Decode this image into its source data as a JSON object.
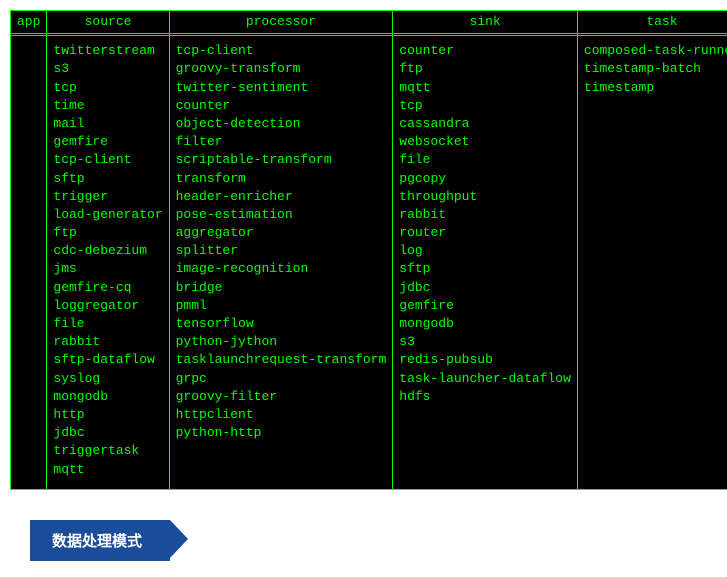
{
  "table": {
    "columns": [
      {
        "header": "app",
        "items": []
      },
      {
        "header": "source",
        "items": [
          "twitterstream",
          "s3",
          "tcp",
          "time",
          "mail",
          "gemfire",
          "tcp-client",
          "sftp",
          "trigger",
          "load-generator",
          "ftp",
          "cdc-debezium",
          "jms",
          "gemfire-cq",
          "loggregator",
          "file",
          "rabbit",
          "sftp-dataflow",
          "syslog",
          "mongodb",
          "http",
          "jdbc",
          "triggertask",
          "mqtt"
        ]
      },
      {
        "header": "processor",
        "items": [
          "tcp-client",
          "groovy-transform",
          "twitter-sentiment",
          "counter",
          "object-detection",
          "filter",
          "scriptable-transform",
          "transform",
          "header-enricher",
          "pose-estimation",
          "aggregator",
          "splitter",
          "image-recognition",
          "bridge",
          "pmml",
          "tensorflow",
          "python-jython",
          "tasklaunchrequest-transform",
          "grpc",
          "groovy-filter",
          "httpclient",
          "python-http"
        ]
      },
      {
        "header": "sink",
        "items": [
          "counter",
          "ftp",
          "mqtt",
          "tcp",
          "cassandra",
          "websocket",
          "file",
          "pgcopy",
          "throughput",
          "rabbit",
          "router",
          "log",
          "sftp",
          "jdbc",
          "gemfire",
          "mongodb",
          "s3",
          "redis-pubsub",
          "task-launcher-dataflow",
          "hdfs"
        ]
      },
      {
        "header": "task",
        "items": [
          "composed-task-runner",
          "timestamp-batch",
          "timestamp"
        ]
      }
    ]
  },
  "section_title": "数据处理模式"
}
